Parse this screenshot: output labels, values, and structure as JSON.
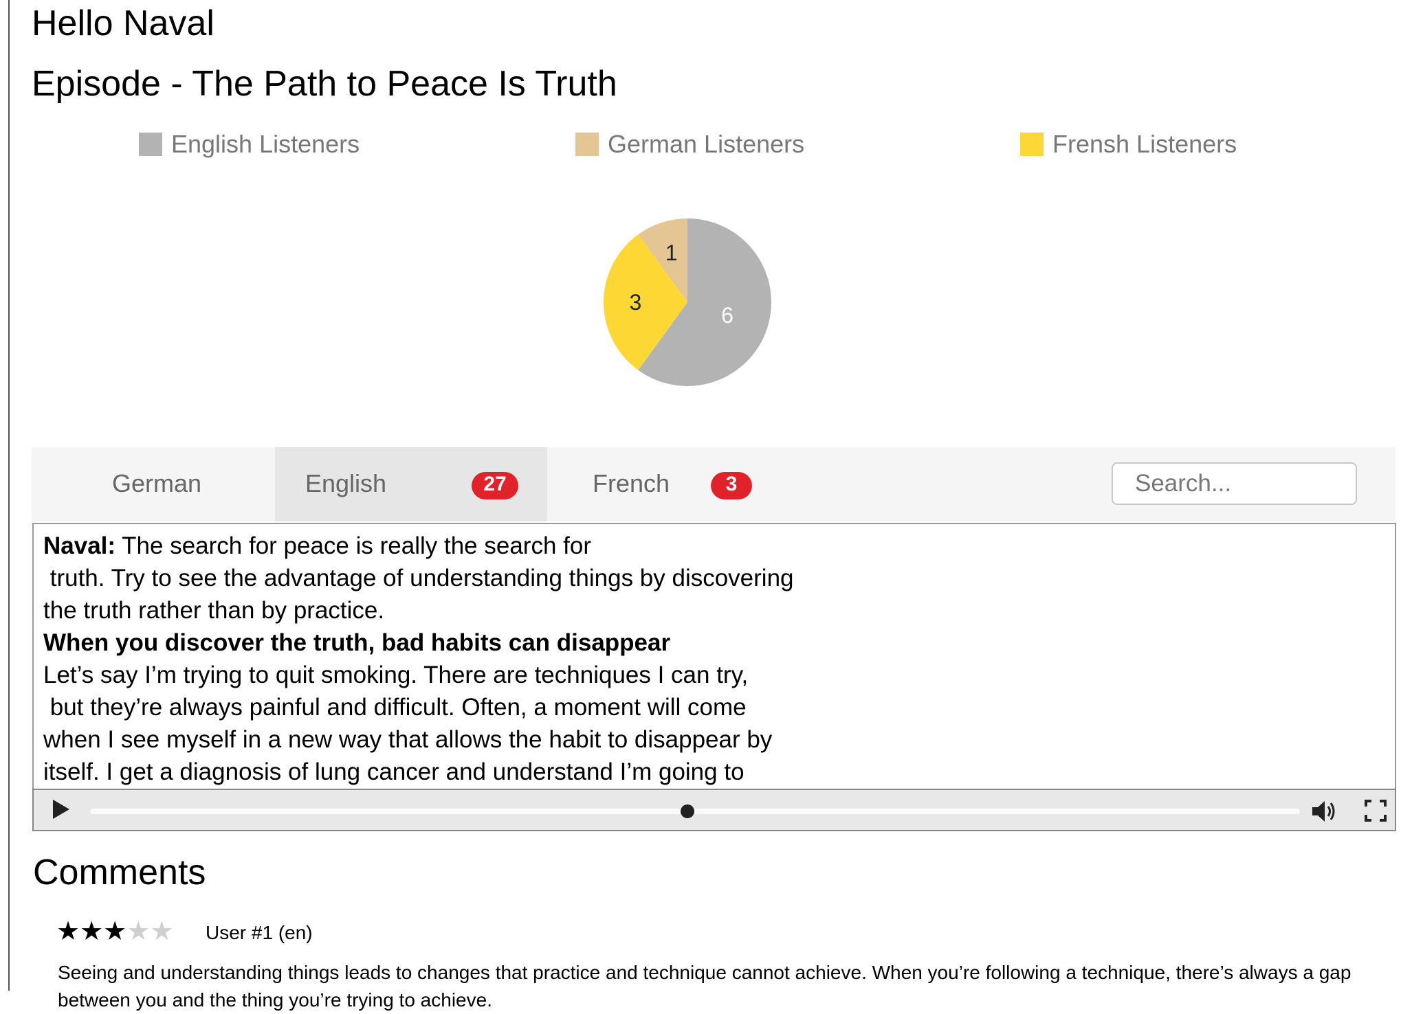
{
  "greeting": "Hello Naval",
  "episode": {
    "title": "Episode - The Path to Peace Is Truth"
  },
  "chart_data": {
    "type": "pie",
    "series": [
      {
        "name": "English Listeners",
        "value": 6,
        "color": "#b3b3b3"
      },
      {
        "name": "German Listeners",
        "value": 1,
        "color": "#e4c594"
      },
      {
        "name": "Frensh Listeners",
        "value": 3,
        "color": "#fdd835"
      }
    ],
    "legend_position": "top"
  },
  "tabs": [
    {
      "label": "German",
      "badge": ""
    },
    {
      "label": "English",
      "badge": "27"
    },
    {
      "label": "French",
      "badge": "3"
    }
  ],
  "search": {
    "placeholder": "Search..."
  },
  "transcript": {
    "speaker": "Naval:",
    "line1": " The search for peace is really the search for",
    "line2": " truth. Try to see the advantage of understanding things by discovering",
    "line3": "the truth rather than by practice.",
    "heading": "When you discover the truth, bad habits can disappear",
    "line4": "Let’s say I’m trying to quit smoking. There are techniques I can try,",
    "line5": " but they’re always painful and difficult. Often, a moment will come",
    "line6": "when I see myself in a new way that allows the habit to disappear by",
    "line7": "itself. I get a diagnosis of lung cancer and understand I’m going to"
  },
  "player": {
    "progress": 0.494,
    "icons": {
      "play": "play-icon",
      "volume": "volume-icon",
      "fullscreen": "fullscreen-icon"
    }
  },
  "comments": {
    "title": "Comments",
    "items": [
      {
        "rating": 3,
        "max_rating": 5,
        "user": "User #1 (en)",
        "text": "Seeing and understanding things leads to changes that practice and technique cannot achieve. When you’re following a technique, there’s always a gap between you and the thing you’re trying to achieve."
      }
    ]
  }
}
